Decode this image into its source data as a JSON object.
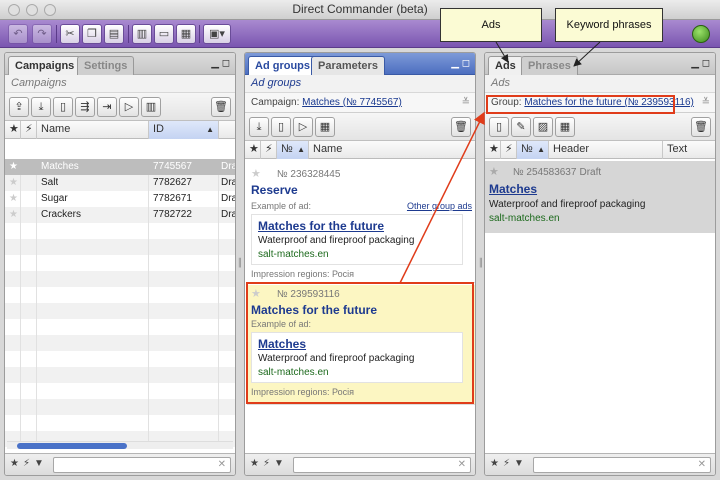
{
  "window": {
    "title": "Direct Commander (beta)"
  },
  "toolbar": {
    "buttons": [
      "undo-icon",
      "redo-icon",
      "cut-icon",
      "copy-icon",
      "paste-icon",
      "stats-icon",
      "battery-icon",
      "calculator-icon",
      "view-menu-icon"
    ]
  },
  "campaigns_panel": {
    "tabs": [
      "Campaigns",
      "Settings"
    ],
    "subtitle": "Campaigns",
    "columns": {
      "star": "★",
      "flash": "⚡",
      "name": "Name",
      "id": "ID",
      "sort": "▲"
    },
    "rows": [
      {
        "name": "Matches",
        "id": "7745567",
        "status": "Dra",
        "selected": true
      },
      {
        "name": "Salt",
        "id": "7782627",
        "status": "Dra",
        "selected": false
      },
      {
        "name": "Sugar",
        "id": "7782671",
        "status": "Dra",
        "selected": false
      },
      {
        "name": "Crackers",
        "id": "7782722",
        "status": "Dra",
        "selected": false
      }
    ]
  },
  "groups_panel": {
    "tabs": [
      "Ad groups",
      "Parameters"
    ],
    "subtitle": "Ad groups",
    "campaign_label": "Campaign:",
    "campaign_link": "Matches (№ 7745567)",
    "columns": {
      "num": "№",
      "sort": "▲",
      "name": "Name"
    },
    "groups": [
      {
        "number": "№ 236328445",
        "title": "Reserve",
        "example_label": "Example of ad:",
        "other_link": "Other group ads",
        "ad_title": "Matches for the future",
        "ad_text": "Waterproof and fireproof packaging",
        "ad_url": "salt-matches.en",
        "regions": "Impression regions: Росія"
      },
      {
        "number": "№ 239593116",
        "title": "Matches for the future",
        "example_label": "Example of ad:",
        "ad_title": "Matches",
        "ad_text": "Waterproof and fireproof packaging",
        "ad_url": "salt-matches.en",
        "regions": "Impression regions: Росія"
      }
    ]
  },
  "ads_panel": {
    "tabs": [
      "Ads",
      "Phrases"
    ],
    "subtitle": "Ads",
    "group_label": "Group:",
    "group_link": "Matches for the future (№ 239593116)",
    "columns": {
      "num": "№",
      "sort": "▲",
      "header": "Header",
      "text": "Text"
    },
    "ad": {
      "number": "№ 254583637",
      "status": "Draft",
      "title": "Matches",
      "text": "Waterproof and fireproof packaging",
      "url": "salt-matches.en"
    }
  },
  "annotations": {
    "ads": "Ads",
    "keyword_phrases": "Keyword phrases"
  },
  "colors": {
    "toolbar": "#8a66bf",
    "highlight_border": "#e03c1a",
    "callout_bg": "#fbfbd4",
    "link": "#1d3a8f"
  }
}
